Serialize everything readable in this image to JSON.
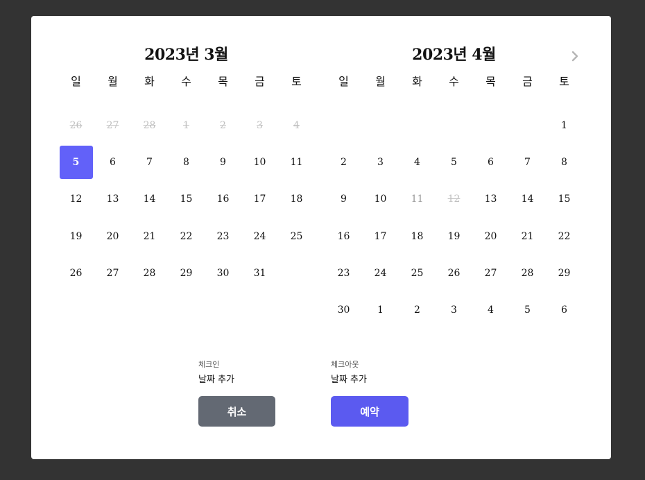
{
  "calendar": {
    "weekdays": [
      "일",
      "월",
      "화",
      "수",
      "목",
      "금",
      "토"
    ],
    "next_icon": "chevron-right-icon",
    "months": [
      {
        "title": "2023년 3월",
        "weeks": [
          [
            {
              "d": "26",
              "s": "disabled"
            },
            {
              "d": "27",
              "s": "disabled"
            },
            {
              "d": "28",
              "s": "disabled"
            },
            {
              "d": "1",
              "s": "disabled"
            },
            {
              "d": "2",
              "s": "disabled"
            },
            {
              "d": "3",
              "s": "disabled"
            },
            {
              "d": "4",
              "s": "disabled"
            }
          ],
          [
            {
              "d": "5",
              "s": "selected"
            },
            {
              "d": "6"
            },
            {
              "d": "7"
            },
            {
              "d": "8"
            },
            {
              "d": "9"
            },
            {
              "d": "10"
            },
            {
              "d": "11"
            }
          ],
          [
            {
              "d": "12"
            },
            {
              "d": "13"
            },
            {
              "d": "14"
            },
            {
              "d": "15"
            },
            {
              "d": "16"
            },
            {
              "d": "17"
            },
            {
              "d": "18"
            }
          ],
          [
            {
              "d": "19"
            },
            {
              "d": "20"
            },
            {
              "d": "21"
            },
            {
              "d": "22"
            },
            {
              "d": "23"
            },
            {
              "d": "24"
            },
            {
              "d": "25"
            }
          ],
          [
            {
              "d": "26"
            },
            {
              "d": "27"
            },
            {
              "d": "28"
            },
            {
              "d": "29"
            },
            {
              "d": "30"
            },
            {
              "d": "31"
            },
            {
              "d": "",
              "s": "empty"
            }
          ]
        ]
      },
      {
        "title": "2023년 4월",
        "weeks": [
          [
            {
              "d": "",
              "s": "empty"
            },
            {
              "d": "",
              "s": "empty"
            },
            {
              "d": "",
              "s": "empty"
            },
            {
              "d": "",
              "s": "empty"
            },
            {
              "d": "",
              "s": "empty"
            },
            {
              "d": "",
              "s": "empty"
            },
            {
              "d": "1"
            }
          ],
          [
            {
              "d": "2"
            },
            {
              "d": "3"
            },
            {
              "d": "4"
            },
            {
              "d": "5"
            },
            {
              "d": "6"
            },
            {
              "d": "7"
            },
            {
              "d": "8"
            }
          ],
          [
            {
              "d": "9"
            },
            {
              "d": "10"
            },
            {
              "d": "11",
              "s": "muted"
            },
            {
              "d": "12",
              "s": "disabled"
            },
            {
              "d": "13"
            },
            {
              "d": "14"
            },
            {
              "d": "15"
            }
          ],
          [
            {
              "d": "16"
            },
            {
              "d": "17"
            },
            {
              "d": "18"
            },
            {
              "d": "19"
            },
            {
              "d": "20"
            },
            {
              "d": "21"
            },
            {
              "d": "22"
            }
          ],
          [
            {
              "d": "23"
            },
            {
              "d": "24"
            },
            {
              "d": "25"
            },
            {
              "d": "26"
            },
            {
              "d": "27"
            },
            {
              "d": "28"
            },
            {
              "d": "29"
            }
          ],
          [
            {
              "d": "30"
            },
            {
              "d": "1"
            },
            {
              "d": "2"
            },
            {
              "d": "3"
            },
            {
              "d": "4"
            },
            {
              "d": "5"
            },
            {
              "d": "6"
            }
          ]
        ]
      }
    ]
  },
  "checkin": {
    "label": "체크인",
    "value": "날짜 추가"
  },
  "checkout": {
    "label": "체크아웃",
    "value": "날짜 추가"
  },
  "buttons": {
    "cancel": "취소",
    "reserve": "예약"
  },
  "colors": {
    "selected": "#6261f9",
    "reserve": "#5b5af0",
    "cancel": "#636973",
    "backdrop": "#333333"
  }
}
